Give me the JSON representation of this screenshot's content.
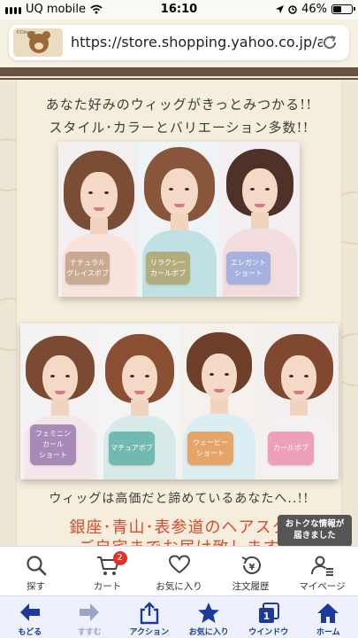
{
  "status_bar": {
    "carrier": "UQ mobile",
    "time": "16:10",
    "battery_percent": "46%",
    "battery_level": 0.46
  },
  "address_bar": {
    "url": "https://store.shopping.yahoo.co.jp/a...",
    "favicon_caption": "©Disney"
  },
  "page": {
    "headline_1": "あなた好みのウィッグがきっとみつかる!!",
    "headline_2": "スタイル･カラーとバリエーション多数!!",
    "row1_tags": [
      {
        "label": "ナチュラル\nグレイスボブ",
        "color": "#c9a98f"
      },
      {
        "label": "リラクシー\nカールボブ",
        "color": "#b3ad7d"
      },
      {
        "label": "エレガント\nショート",
        "color": "#a7b1e0"
      }
    ],
    "row2_tags": [
      {
        "label": "フェミニン\nカール\nショート",
        "color": "#a78ab8"
      },
      {
        "label": "マチュアボブ",
        "color": "#72b9b2"
      },
      {
        "label": "ウェービー\nショート",
        "color": "#e6a568"
      },
      {
        "label": "カールボブ",
        "color": "#ee9fbb"
      }
    ],
    "subheading": "ウィッグは高価だと諦めているあなたへ..!!",
    "red_line_1": "銀座･青山･表参道のヘアスタ",
    "red_line_2": "ご自宅までお届け致します"
  },
  "toast": {
    "line_1": "おトクな情報が",
    "line_2": "届きました"
  },
  "shop_nav": {
    "items": [
      {
        "label": "探す",
        "icon": "search-icon"
      },
      {
        "label": "カート",
        "icon": "cart-icon",
        "badge": "2"
      },
      {
        "label": "お気に入り",
        "icon": "heart-icon"
      },
      {
        "label": "注文履歴",
        "icon": "order-history-icon"
      },
      {
        "label": "マイページ",
        "icon": "user-icon"
      }
    ]
  },
  "toolbar": {
    "items": [
      {
        "label": "もどる",
        "icon": "back-arrow-icon"
      },
      {
        "label": "すすむ",
        "icon": "forward-arrow-icon"
      },
      {
        "label": "アクション",
        "icon": "share-icon"
      },
      {
        "label": "お気に入り",
        "icon": "star-icon"
      },
      {
        "label": "ウインドウ",
        "icon": "windows-icon",
        "count": "1"
      },
      {
        "label": "ホーム",
        "icon": "home-icon"
      }
    ]
  },
  "colors": {
    "accent_red": "#d84a2e",
    "toolbar_blue": "#1d3a9a",
    "badge_red": "#e0312b"
  }
}
